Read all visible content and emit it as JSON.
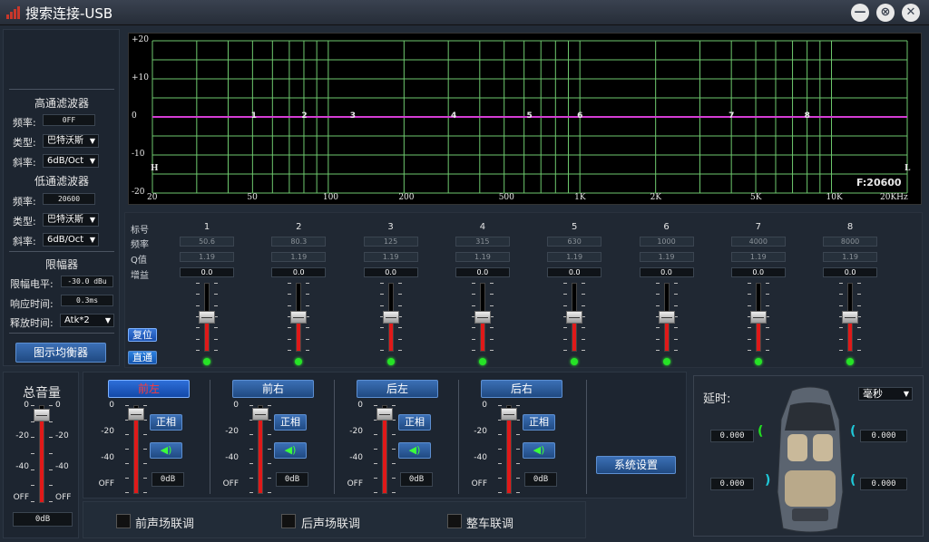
{
  "window": {
    "title": "搜索连接-USB",
    "minimize": "—",
    "restore": "⊗",
    "close": "✕"
  },
  "left": {
    "hpf_title": "高通滤波器",
    "freq_label": "频率:",
    "type_label": "类型:",
    "slope_label": "斜率:",
    "hpf_freq": "0FF",
    "hpf_type": "巴特沃斯",
    "hpf_slope": "6dB/Oct",
    "lpf_title": "低通滤波器",
    "lpf_freq": "20600",
    "lpf_type": "巴特沃斯",
    "lpf_slope": "6dB/Oct",
    "lim_title": "限幅器",
    "lim_level_label": "限幅电平:",
    "lim_level": "-30.0 dBu",
    "resp_label": "响应时间:",
    "resp": "0.3ms",
    "rel_label": "释放时间:",
    "rel": "Atk*2",
    "geq_button": "图示均衡器"
  },
  "graph": {
    "y_ticks": [
      "+20",
      "+10",
      "0",
      "-10",
      "-20"
    ],
    "x_ticks": [
      "20",
      "50",
      "100",
      "200",
      "500",
      "1K",
      "2K",
      "5K",
      "10K",
      "20KHz"
    ],
    "h_marker": "H",
    "l_marker": "L",
    "f_readout": "F:20600",
    "points": [
      "1",
      "2",
      "3",
      "4",
      "5",
      "6",
      "7",
      "8"
    ]
  },
  "eq": {
    "row_labels": [
      "标号",
      "频率",
      "Q值",
      "增益"
    ],
    "bands": [
      {
        "id": "1",
        "freq": "50.6",
        "q": "1.19",
        "gain": "0.0"
      },
      {
        "id": "2",
        "freq": "80.3",
        "q": "1.19",
        "gain": "0.0"
      },
      {
        "id": "3",
        "freq": "125",
        "q": "1.19",
        "gain": "0.0"
      },
      {
        "id": "4",
        "freq": "315",
        "q": "1.19",
        "gain": "0.0"
      },
      {
        "id": "5",
        "freq": "630",
        "q": "1.19",
        "gain": "0.0"
      },
      {
        "id": "6",
        "freq": "1000",
        "q": "1.19",
        "gain": "0.0"
      },
      {
        "id": "7",
        "freq": "4000",
        "q": "1.19",
        "gain": "0.0"
      },
      {
        "id": "8",
        "freq": "8000",
        "q": "1.19",
        "gain": "0.0"
      }
    ],
    "reset_button": "复位",
    "bypass_button": "直通"
  },
  "master": {
    "title": "总音量",
    "scale": [
      "0",
      "-20",
      "-40",
      "OFF"
    ],
    "value": "0dB",
    "level": 0.96
  },
  "channels": [
    {
      "name": "前左",
      "phase": "正相",
      "value": "0dB",
      "level": 0.96
    },
    {
      "name": "前右",
      "phase": "正相",
      "value": "0dB",
      "level": 0.96
    },
    {
      "name": "后左",
      "phase": "正相",
      "value": "0dB",
      "level": 0.96
    },
    {
      "name": "后右",
      "phase": "正相",
      "value": "0dB",
      "level": 0.96
    }
  ],
  "channel_scale": [
    "0",
    "-20",
    "-40",
    "OFF"
  ],
  "system_button": "系统设置",
  "links": {
    "front": "前声场联调",
    "rear": "后声场联调",
    "all": "整车联调"
  },
  "delay": {
    "title": "延时:",
    "unit": "毫秒",
    "fl": "0.000",
    "fr": "0.000",
    "rl": "0.000",
    "rr": "0.000"
  },
  "colors": {
    "accent": "#2e6ed8",
    "curve": "#d43cd4",
    "grid": "#6ec96e",
    "meter": "#e01919"
  }
}
